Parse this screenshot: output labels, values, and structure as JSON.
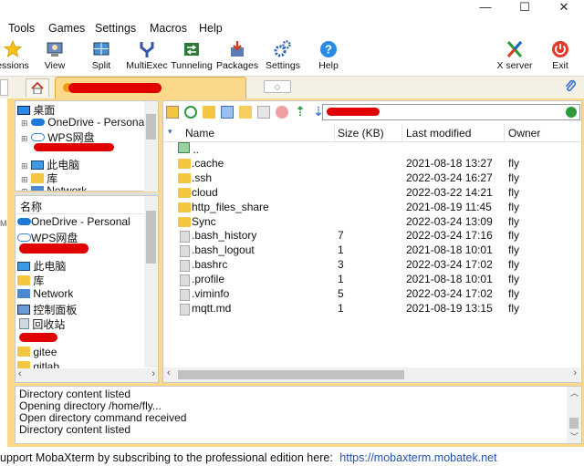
{
  "menu": [
    "Tools",
    "Games",
    "Settings",
    "Macros",
    "Help"
  ],
  "toolbar": [
    {
      "label": "essions",
      "icon": "star-icon"
    },
    {
      "label": "View",
      "icon": "view-icon"
    },
    {
      "label": "Split",
      "icon": "split-icon"
    },
    {
      "label": "MultiExec",
      "icon": "multiexec-icon"
    },
    {
      "label": "Tunneling",
      "icon": "tunneling-icon"
    },
    {
      "label": "Packages",
      "icon": "packages-icon"
    },
    {
      "label": "Settings",
      "icon": "gear-icon"
    },
    {
      "label": "Help",
      "icon": "help-icon"
    }
  ],
  "toolbar_right": [
    {
      "label": "X server",
      "icon": "xserver-icon"
    },
    {
      "label": "Exit",
      "icon": "power-icon"
    }
  ],
  "tree": [
    {
      "label": "桌面",
      "indent": 0
    },
    {
      "label": "OneDrive - Personal",
      "indent": 1
    },
    {
      "label": "WPS网盘",
      "indent": 1
    },
    {
      "label": "此电脑",
      "indent": 1
    },
    {
      "label": "库",
      "indent": 1
    },
    {
      "label": "Network",
      "indent": 1
    }
  ],
  "lower_list": {
    "header": "名称",
    "items": [
      "OneDrive - Personal",
      "WPS网盘",
      "此电脑",
      "库",
      "Network",
      "控制面板",
      "回收站",
      "gitee",
      "gitlab"
    ]
  },
  "file_columns": [
    "Name",
    "Size (KB)",
    "Last modified",
    "Owner"
  ],
  "files": [
    {
      "name": "..",
      "size": "",
      "modified": "",
      "owner": "",
      "kind": "up"
    },
    {
      "name": ".cache",
      "size": "",
      "modified": "2021-08-18 13:27",
      "owner": "fly",
      "kind": "folder"
    },
    {
      "name": ".ssh",
      "size": "",
      "modified": "2022-03-24 16:27",
      "owner": "fly",
      "kind": "folder"
    },
    {
      "name": "cloud",
      "size": "",
      "modified": "2022-03-22 14:21",
      "owner": "fly",
      "kind": "folder"
    },
    {
      "name": "http_files_share",
      "size": "",
      "modified": "2021-08-19 11:45",
      "owner": "fly",
      "kind": "folder"
    },
    {
      "name": "Sync",
      "size": "",
      "modified": "2022-03-24 13:09",
      "owner": "fly",
      "kind": "folder"
    },
    {
      "name": ".bash_history",
      "size": "7",
      "modified": "2022-03-24 17:16",
      "owner": "fly",
      "kind": "file"
    },
    {
      "name": ".bash_logout",
      "size": "1",
      "modified": "2021-08-18 10:01",
      "owner": "fly",
      "kind": "file"
    },
    {
      "name": ".bashrc",
      "size": "3",
      "modified": "2022-03-24 17:02",
      "owner": "fly",
      "kind": "file"
    },
    {
      "name": ".profile",
      "size": "1",
      "modified": "2021-08-18 10:01",
      "owner": "fly",
      "kind": "file"
    },
    {
      "name": ".viminfo",
      "size": "5",
      "modified": "2022-03-24 17:02",
      "owner": "fly",
      "kind": "file"
    },
    {
      "name": "mqtt.md",
      "size": "1",
      "modified": "2021-08-19 13:15",
      "owner": "fly",
      "kind": "file"
    }
  ],
  "log": [
    "Directory content listed",
    "Opening directory /home/fly...",
    "Open directory command received",
    "Directory content listed"
  ],
  "status": {
    "text": "upport MobaXterm by subscribing to the professional edition here:",
    "link": "https://mobaxterm.mobatek.net"
  },
  "colors": {
    "frame": "#fdd888",
    "folder": "#f4c542",
    "link": "#2050b0"
  }
}
